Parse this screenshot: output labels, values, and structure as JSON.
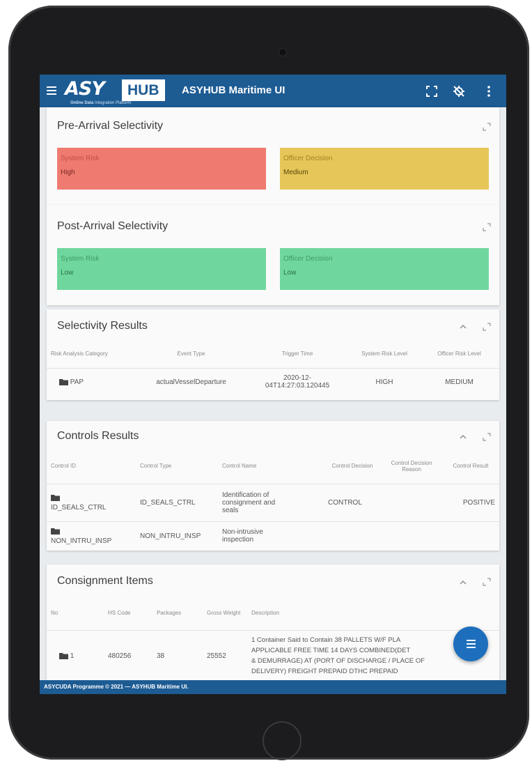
{
  "app": {
    "logo_brand": "ASY",
    "logo_hub": "HUB",
    "logo_sub_bold": "Online Data",
    "logo_sub": "Integration Platform",
    "title": "ASYHUB Maritime UI"
  },
  "icons": {
    "menu": "menu-icon",
    "fullscreen": "fullscreen-icon",
    "location_off": "no-location-icon",
    "more": "more-vert-icon",
    "expand": "expand-icon",
    "collapse": "chevron-up-icon",
    "folder": "folder-icon",
    "fab": "menu-icon"
  },
  "colors": {
    "brand": "#1d5b93",
    "high": "#ef7b70",
    "medium": "#e6c659",
    "low": "#6fd79d"
  },
  "pre_arrival": {
    "title": "Pre-Arrival Selectivity",
    "system_risk_label": "System Risk",
    "system_risk_value": "High",
    "officer_decision_label": "Officer Decision",
    "officer_decision_value": "Medium"
  },
  "post_arrival": {
    "title": "Post-Arrival Selectivity",
    "system_risk_label": "System Risk",
    "system_risk_value": "Low",
    "officer_decision_label": "Officer Decision",
    "officer_decision_value": "Low"
  },
  "selectivity_results": {
    "title": "Selectivity Results",
    "columns": [
      "Risk Analysis Category",
      "Event Type",
      "Trigger Time",
      "System Risk Level",
      "Officer Risk Level"
    ],
    "rows": [
      {
        "category": "PAP",
        "event_type": "actualVesselDeparture",
        "trigger_time_line1": "2020-12-",
        "trigger_time_line2": "04T14:27:03.120445",
        "system_risk": "HIGH",
        "officer_risk": "MEDIUM"
      }
    ]
  },
  "controls_results": {
    "title": "Controls Results",
    "columns": [
      "Control ID",
      "Control Type",
      "Control Name",
      "Control Decision",
      "Control Decision Reason",
      "Control Result"
    ],
    "rows": [
      {
        "id": "ID_SEALS_CTRL",
        "type": "ID_SEALS_CTRL",
        "name_line1": "Identification of",
        "name_line2": "consignment and",
        "name_line3": "seals",
        "decision": "CONTROL",
        "reason": "",
        "result": "POSITIVE"
      },
      {
        "id": "NON_INTRU_INSP",
        "type": "NON_INTRU_INSP",
        "name_line1": "Non-intrusive",
        "name_line2": "inspection",
        "decision": "",
        "reason": "",
        "result": ""
      }
    ]
  },
  "consignment_items": {
    "title": "Consignment Items",
    "columns": [
      "No",
      "HS Code",
      "Packages",
      "Gross Weight",
      "Description"
    ],
    "rows": [
      {
        "no": "1",
        "hs_code": "480256",
        "packages": "38",
        "gross_weight": "25552",
        "desc_line1": "1 Container Said to Contain 38 PALLETS W/F PLA",
        "desc_line2": "APPLICABLE FREE TIME 14 DAYS COMBINED(DET",
        "desc_line3": "& DEMURRAGE) AT (PORT OF DISCHARGE / PLACE OF",
        "desc_line4": "DELIVERY) FREIGHT PREPAID DTHC PREPAID"
      }
    ]
  },
  "footer": {
    "text": "ASYCUDA Programme © 2021 — ASYHUB Maritime UI."
  }
}
